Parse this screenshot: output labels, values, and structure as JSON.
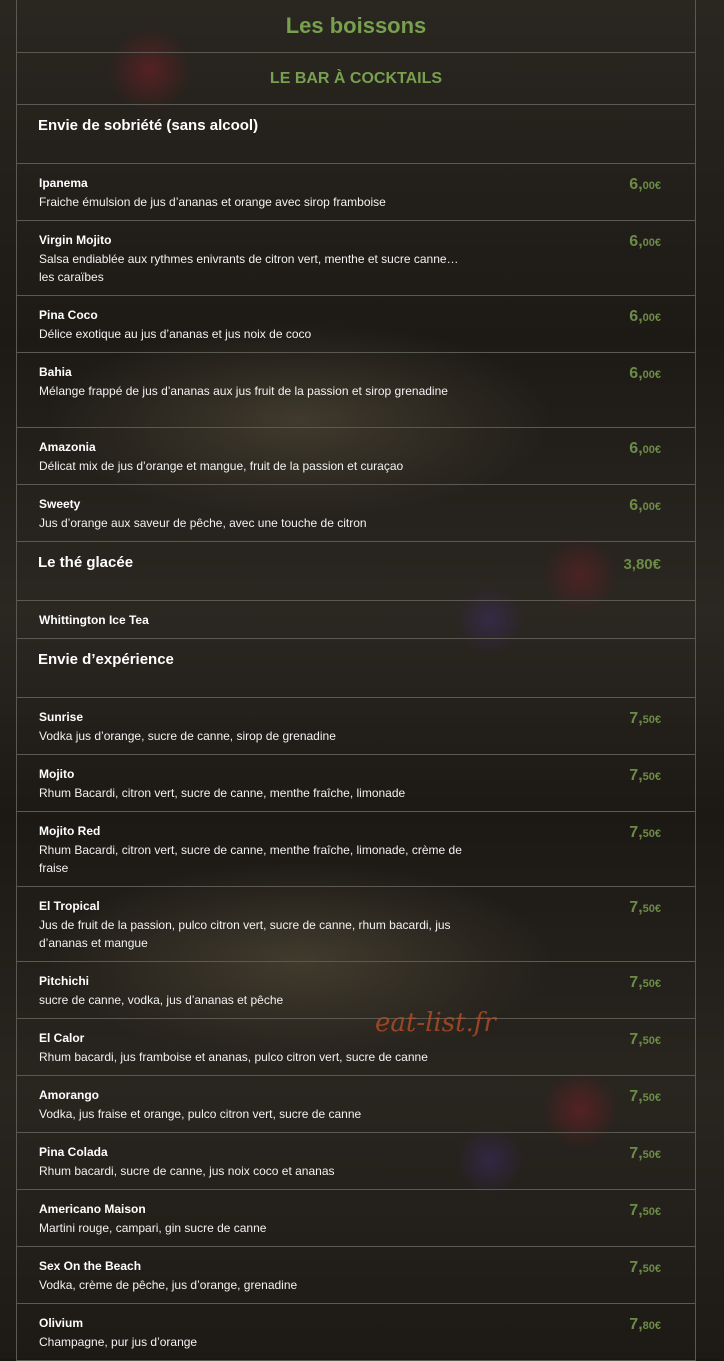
{
  "header": {
    "title": "Les boissons",
    "subtitle": "LE BAR À COCKTAILS"
  },
  "sections": {
    "sans_alcool": {
      "title": "Envie de sobriété (sans alcool)"
    },
    "the_glacee": {
      "title": "Le thé glacée",
      "price": "3,80€"
    },
    "experience": {
      "title": "Envie d’expérience"
    }
  },
  "sans_alcool_items": [
    {
      "name": "Ipanema",
      "desc": "Fraiche émulsion de jus d’ananas et orange avec sirop framboise",
      "price_main": "6,",
      "price_cents": "00€"
    },
    {
      "name": "Virgin Mojito",
      "desc": "Salsa endiablée aux rythmes enivrants de citron vert, menthe et sucre canne…les caraïbes",
      "price_main": "6,",
      "price_cents": "00€"
    },
    {
      "name": "Pina Coco",
      "desc": "Délice exotique au jus d’ananas et jus noix de coco",
      "price_main": "6,",
      "price_cents": "00€"
    },
    {
      "name": "Bahia",
      "desc": "Mélange frappé de jus d’ananas aux jus fruit de la passion et sirop grenadine",
      "price_main": "6,",
      "price_cents": "00€"
    },
    {
      "name": "Amazonia",
      "desc": "Délicat mix de jus d’orange et mangue, fruit de la passion et curaçao",
      "price_main": "6,",
      "price_cents": "00€"
    },
    {
      "name": "Sweety",
      "desc": "Jus d’orange aux saveur de pêche, avec une touche de citron",
      "price_main": "6,",
      "price_cents": "00€"
    }
  ],
  "the_items": [
    {
      "name": "Whittington Ice Tea"
    }
  ],
  "experience_items": [
    {
      "name": "Sunrise",
      "desc": "Vodka jus d’orange, sucre de canne, sirop de grenadine",
      "price_main": "7,",
      "price_cents": "50€"
    },
    {
      "name": "Mojito",
      "desc": "Rhum Bacardi, citron vert, sucre de canne, menthe fraîche, limonade",
      "price_main": "7,",
      "price_cents": "50€"
    },
    {
      "name": "Mojito Red",
      "desc": "Rhum Bacardi, citron vert, sucre de canne, menthe fraîche, limonade, crème de fraise",
      "price_main": "7,",
      "price_cents": "50€"
    },
    {
      "name": "El Tropical",
      "desc": "Jus de fruit de la passion, pulco citron vert, sucre de canne, rhum bacardi, jus d’ananas et mangue",
      "price_main": "7,",
      "price_cents": "50€"
    },
    {
      "name": "Pitchichi",
      "desc": "sucre de canne, vodka, jus d’ananas et pêche",
      "price_main": "7,",
      "price_cents": "50€"
    },
    {
      "name": "El Calor",
      "desc": "Rhum bacardi, jus framboise et ananas, pulco citron vert, sucre de canne",
      "price_main": "7,",
      "price_cents": "50€"
    },
    {
      "name": "Amorango",
      "desc": "Vodka, jus fraise et orange, pulco citron vert, sucre de canne",
      "price_main": "7,",
      "price_cents": "50€"
    },
    {
      "name": "Pina Colada",
      "desc": "Rhum bacardi, sucre de canne, jus noix coco et ananas",
      "price_main": "7,",
      "price_cents": "50€"
    },
    {
      "name": "Americano Maison",
      "desc": "Martini rouge, campari, gin sucre de canne",
      "price_main": "7,",
      "price_cents": "50€"
    },
    {
      "name": "Sex On the Beach",
      "desc": "Vodka, crème de pêche, jus d’orange, grenadine",
      "price_main": "7,",
      "price_cents": "50€"
    },
    {
      "name": "Olivium",
      "desc": "Champagne, pur jus d’orange",
      "price_main": "7,",
      "price_cents": "80€"
    }
  ],
  "watermark": "eat-list.fr"
}
